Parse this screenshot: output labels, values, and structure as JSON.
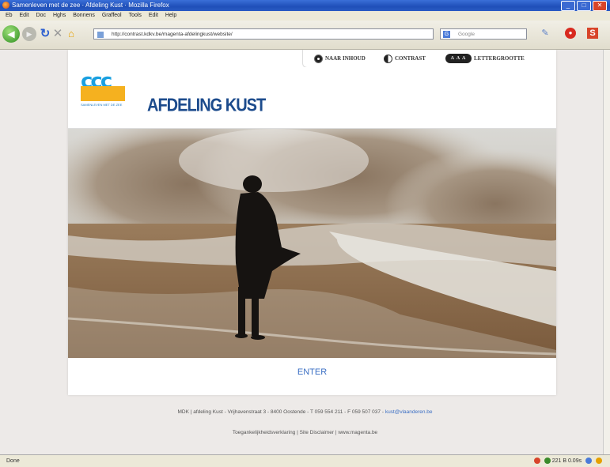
{
  "window": {
    "title": "Samenleven met de zee · Afdeling Kust · Mozilla Firefox",
    "controls": [
      "_",
      "□",
      "✕"
    ]
  },
  "menu": [
    "Eb",
    "Edit",
    "Doc",
    "Hghs",
    "Bonnens",
    "Graffeol",
    "Tools",
    "Edit",
    "Help"
  ],
  "browser": {
    "url": "http://contrast.kdkv.be/magenta-afdelingkust/website/",
    "search_placeholder": "Google",
    "search_engine_letter": "G"
  },
  "accessibility_toolbar": {
    "skip_label": "NAAR INHOUD",
    "contrast_label": "CONTRAST",
    "fontsize_icon_text": "A A A",
    "fontsize_label": "LETTERGROOTTE"
  },
  "header": {
    "logo_waves": "ccc",
    "logo_tagline": "SAMENLEVEN MET DE ZEE",
    "department_title": "AFDELING KUST"
  },
  "main": {
    "enter_label": "ENTER"
  },
  "footer": {
    "address": "MDK | afdeling Kust - Vrijhavenstraat 3 - 8400 Oostende - T 059 554 211 - F 059 507 037 -",
    "email": "kust@vlaanderen.be",
    "links": [
      "Toegankelijkheidsverklaring",
      "Site Disclaimer",
      "www.magenta.be"
    ],
    "separator": "|"
  },
  "statusbar": {
    "status": "Done",
    "right": "221 B   0.09s"
  },
  "colors": {
    "brand_blue": "#1c4b8c",
    "link_blue": "#3b6fc4",
    "logo_yellow": "#f5b11f",
    "logo_cyan": "#1aa0e0"
  }
}
